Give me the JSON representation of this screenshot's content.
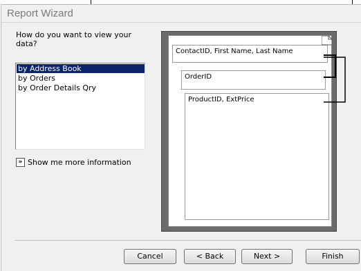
{
  "dialog": {
    "title": "Report Wizard",
    "question": "How do you want to view your data?",
    "view_options": [
      "by Address Book",
      "by Orders",
      "by Order Details Qry"
    ],
    "selected_option": "by Address Book",
    "more_info_label": "Show me more information",
    "more_info_icon": "»"
  },
  "preview": {
    "level1": "ContactID, First Name, Last Name",
    "level2": "OrderID",
    "level3": "ProductID, ExtPrice"
  },
  "buttons": {
    "cancel": "Cancel",
    "back": "< Back",
    "next": "Next >",
    "finish": "Finish"
  },
  "colors": {
    "selection": "#0a246a",
    "preview_frame": "#6b6b6b",
    "dialog_bg": "#f0f0f0"
  }
}
